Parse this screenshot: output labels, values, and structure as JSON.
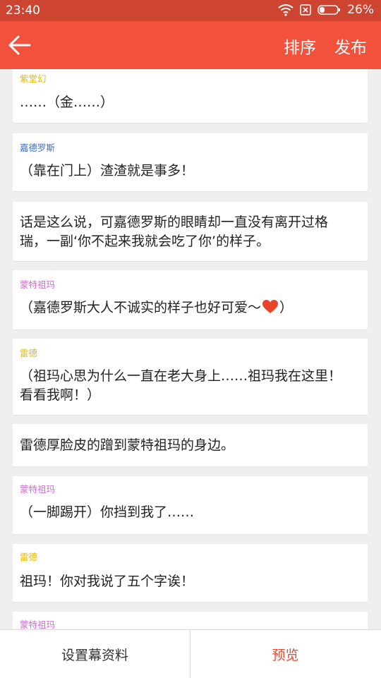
{
  "status": {
    "time": "23:40",
    "battery": "26%"
  },
  "appbar": {
    "sort_label": "排序",
    "publish_label": "发布"
  },
  "messages": [
    {
      "speaker": "紫堂幻",
      "speaker_color": "#e6b800",
      "text": "……（金……）"
    },
    {
      "speaker": "嘉德罗斯",
      "speaker_color": "#3f6fc2",
      "text": "（靠在门上）渣渣就是事多！"
    },
    {
      "speaker": "",
      "text_line1": "话是这么说，可嘉德罗斯的眼睛却一直没有离开过格",
      "text_line2": "瑞，一副‘你不起来我就会吃了你’的样子。"
    },
    {
      "speaker": "蒙特祖玛",
      "speaker_color": "#d36ad6",
      "text_before": "（嘉德罗斯大人不诚实的样子也好可爱～",
      "text_after": "）"
    },
    {
      "speaker": "雷德",
      "speaker_color": "#e6b800",
      "text_line1": "（祖玛心思为什么一直在老大身上……祖玛我在这里！",
      "text_line2": "看看我啊！）"
    },
    {
      "speaker": "",
      "text": "雷德厚脸皮的蹭到蒙特祖玛的身边。"
    },
    {
      "speaker": "蒙特祖玛",
      "speaker_color": "#d36ad6",
      "text": "（一脚踢开）你挡到我了……"
    },
    {
      "speaker": "雷德",
      "speaker_color": "#e6b800",
      "text": "祖玛！你对我说了五个字诶！"
    },
    {
      "speaker": "蒙特祖玛",
      "speaker_color": "#d36ad6"
    }
  ],
  "bottom": {
    "settings_label": "设置幕资料",
    "preview_label": "预览"
  },
  "colors": {
    "status_bar": "#cd4430",
    "app_bar": "#f2523b",
    "accent": "#e8472f",
    "heart": "#e8432d"
  }
}
